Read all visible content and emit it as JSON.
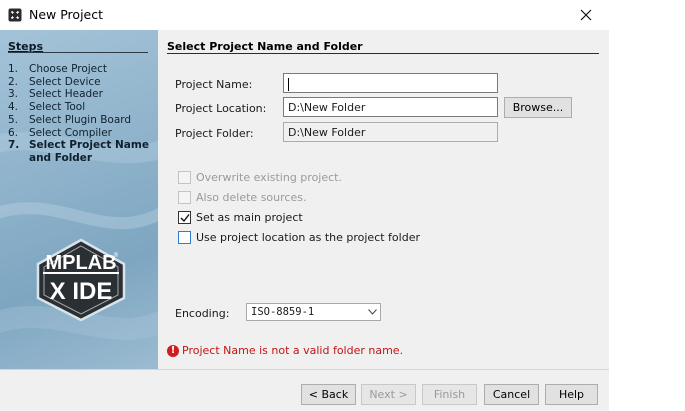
{
  "window": {
    "title": "New Project",
    "app_icon": "netbeans-cube-icon",
    "close_glyph": "✕"
  },
  "steps": {
    "heading": "Steps",
    "items": [
      {
        "num": "1.",
        "label": "Choose Project",
        "current": false
      },
      {
        "num": "2.",
        "label": "Select Device",
        "current": false
      },
      {
        "num": "3.",
        "label": "Select Header",
        "current": false
      },
      {
        "num": "4.",
        "label": "Select Tool",
        "current": false
      },
      {
        "num": "5.",
        "label": "Select Plugin Board",
        "current": false
      },
      {
        "num": "6.",
        "label": "Select Compiler",
        "current": false
      },
      {
        "num": "7.",
        "label": "Select Project Name and Folder",
        "current": true
      }
    ]
  },
  "logo": {
    "line1": "MPLAB",
    "line2": "X IDE",
    "registered": "®"
  },
  "main": {
    "section_title": "Select Project Name and Folder",
    "project_name": {
      "label": "Project Name:",
      "value": ""
    },
    "project_location": {
      "label": "Project Location:",
      "value": "D:\\New Folder"
    },
    "browse_label": "Browse...",
    "project_folder": {
      "label": "Project Folder:",
      "value": "D:\\New Folder"
    },
    "options": {
      "overwrite": {
        "label": "Overwrite existing project.",
        "checked": false,
        "enabled": false
      },
      "delete_sources": {
        "label": "Also delete sources.",
        "checked": false,
        "enabled": false
      },
      "main_project": {
        "label": "Set as main project",
        "checked": true,
        "enabled": true
      },
      "use_location": {
        "label": "Use project location as the project folder",
        "checked": false,
        "enabled": true
      }
    },
    "encoding": {
      "label": "Encoding:",
      "value": "ISO-8859-1"
    },
    "error": {
      "icon": "error-icon",
      "glyph": "!",
      "text": "Project Name is not a valid folder name."
    }
  },
  "footer": {
    "back_label": "< Back",
    "next_label": "Next >",
    "finish_label": "Finish",
    "cancel_label": "Cancel",
    "help_label": "Help"
  },
  "colors": {
    "error": "#c01515",
    "panel_blue": "#8fb3cb",
    "focus_blue": "#2f7bd4"
  }
}
